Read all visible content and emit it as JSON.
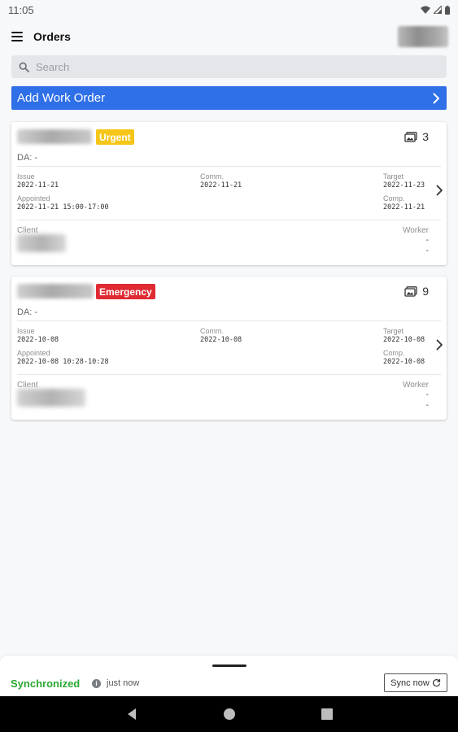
{
  "status_bar": {
    "time": "11:05"
  },
  "header": {
    "title": "Orders"
  },
  "search": {
    "placeholder": "Search"
  },
  "add_button": {
    "label": "Add Work Order"
  },
  "labels": {
    "da_prefix": "DA: -",
    "issue": "Issue",
    "comm": "Comm.",
    "target": "Target",
    "appointed": "Appointed",
    "comp": "Comp.",
    "client": "Client",
    "worker": "Worker"
  },
  "orders": [
    {
      "priority": "Urgent",
      "photo_count": "3",
      "issue": "2022-11-21",
      "comm": "2022-11-21",
      "target": "2022-11-23",
      "appointed": "2022-11-21 15:00-17:00",
      "comp": "2022-11-21",
      "worker_line1": "-",
      "worker_line2": "-"
    },
    {
      "priority": "Emergency",
      "photo_count": "9",
      "issue": "2022-10-08",
      "comm": "2022-10-08",
      "target": "2022-10-08",
      "appointed": "2022-10-08 10:28-10:28",
      "comp": "2022-10-08",
      "worker_line1": "-",
      "worker_line2": "-"
    }
  ],
  "sync": {
    "status": "Synchronized",
    "time": "just now",
    "button_label": "Sync now"
  },
  "colors": {
    "accent": "#2f6fe8",
    "urgent": "#f5c518",
    "emergency": "#e02a33",
    "synced": "#2aa830"
  }
}
